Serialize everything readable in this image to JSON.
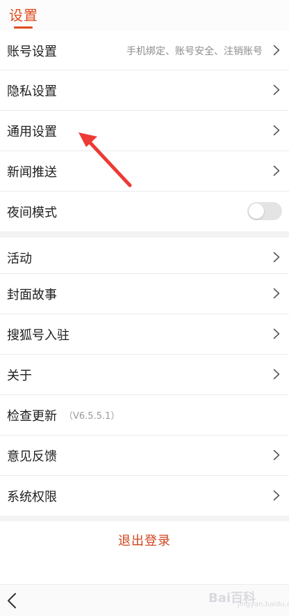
{
  "header": {
    "tab_label": "设置"
  },
  "section1": [
    {
      "label": "账号设置",
      "sub": "手机绑定、账号安全、注销账号"
    },
    {
      "label": "隐私设置"
    },
    {
      "label": "通用设置"
    },
    {
      "label": "新闻推送"
    },
    {
      "label": "夜间模式",
      "toggle_on": false
    }
  ],
  "section2": [
    {
      "label": "活动"
    },
    {
      "label": "封面故事"
    },
    {
      "label": "搜狐号入驻"
    },
    {
      "label": "关于"
    },
    {
      "label": "检查更新",
      "version": "（V6.5.5.1）"
    },
    {
      "label": "意见反馈"
    },
    {
      "label": "系统权限"
    }
  ],
  "logout_label": "退出登录",
  "watermark": {
    "text": "Bai百科",
    "sub": "jingyan.baidu.com"
  },
  "colors": {
    "accent": "#e04a1e",
    "annotation_arrow": "#ec3a35"
  }
}
